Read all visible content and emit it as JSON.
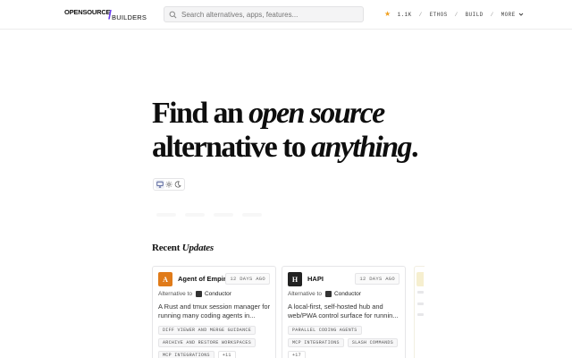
{
  "header": {
    "logo_top": "OPENSOURCE",
    "logo_slash": "/",
    "logo_bottom": "BUILDERS",
    "search_placeholder": "Search alternatives, apps, features...",
    "star_count": "1.1K",
    "nav": [
      "ETHOS",
      "BUILD",
      "MORE"
    ],
    "nav_sep": "/"
  },
  "hero": {
    "line1_prefix": "Find an ",
    "line1_em": "open source",
    "line2_prefix": "alternative to ",
    "line2_em": "anything",
    "line2_suffix": "."
  },
  "theme_switcher": {
    "options": [
      "monitor-icon",
      "sun-icon",
      "moon-icon"
    ],
    "active": "monitor-icon"
  },
  "recent": {
    "prefix": "Recent ",
    "em": "Updates"
  },
  "cards": [
    {
      "icon_letter": "A",
      "icon_color": "#e07b1a",
      "name": "Agent of Empires",
      "ago": "12 DAYS AGO",
      "alt_prefix": "Alternative to",
      "alt_name": "Conductor",
      "description": "A Rust and tmux session manager for running many coding agents in...",
      "tags": [
        "DIFF VIEWER AND MERGE GUIDANCE",
        "ARCHIVE AND RESTORE WORKSPACES",
        "MCP INTEGRATIONS"
      ],
      "more": "+11"
    },
    {
      "icon_letter": "H",
      "icon_color": "#222222",
      "name": "HAPI",
      "ago": "12 DAYS AGO",
      "alt_prefix": "Alternative to",
      "alt_name": "Conductor",
      "description": "A local-first, self-hosted hub and web/PWA control surface for runnin...",
      "tags": [
        "PARALLEL CODING AGENTS",
        "MCP INTEGRATIONS",
        "SLASH COMMANDS"
      ],
      "more": "+17"
    }
  ],
  "colors": {
    "accent": "#6a3df0",
    "star": "#f0a020"
  }
}
